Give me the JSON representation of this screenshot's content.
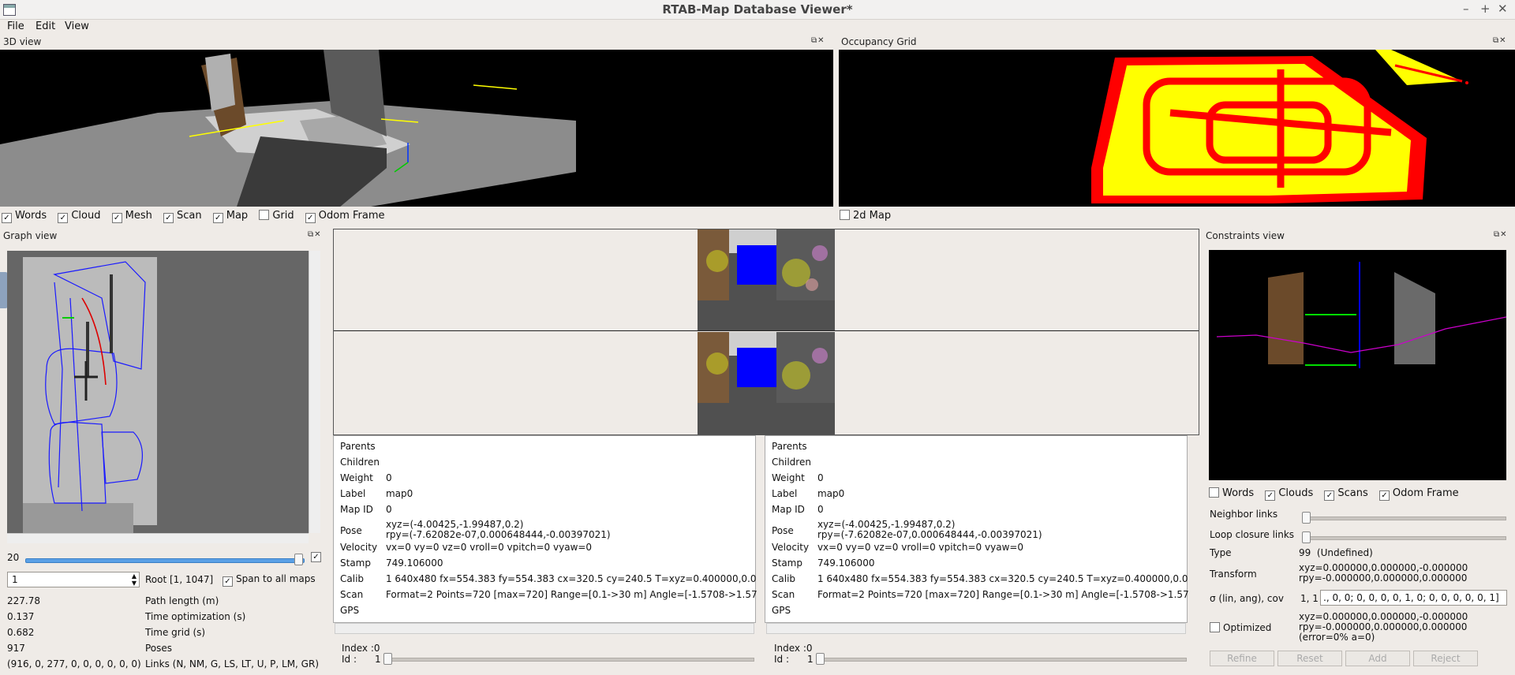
{
  "window": {
    "title": "RTAB-Map Database Viewer*",
    "controls": [
      "–",
      "+",
      "✕"
    ]
  },
  "menu": [
    "File",
    "Edit",
    "View"
  ],
  "view3d": {
    "title": "3D view",
    "checks": [
      {
        "label": "Words",
        "checked": true
      },
      {
        "label": "Cloud",
        "checked": true
      },
      {
        "label": "Mesh",
        "checked": true
      },
      {
        "label": "Scan",
        "checked": true
      },
      {
        "label": "Map",
        "checked": true
      },
      {
        "label": "Grid",
        "checked": false
      },
      {
        "label": "Odom Frame",
        "checked": true
      }
    ]
  },
  "occupancy": {
    "title": "Occupancy Grid",
    "check_label": "2d Map",
    "checked": false
  },
  "graph": {
    "title": "Graph view",
    "slider_value": "20",
    "id_input": "1",
    "root_label": "Root [1, 1047]",
    "span_label": "Span to all maps",
    "stats": [
      {
        "value": "227.78",
        "label": "Path length (m)"
      },
      {
        "value": "0.137",
        "label": "Time optimization (s)"
      },
      {
        "value": "0.682",
        "label": "Time grid (s)"
      },
      {
        "value": "917",
        "label": "Poses"
      },
      {
        "value": "(916, 0, 277, 0, 0, 0, 0, 0, 0)",
        "label": "Links (N, NM, G, LS, LT, U, P, LM, GR)"
      }
    ]
  },
  "info_left": {
    "rows": [
      {
        "k": "Parents",
        "v": ""
      },
      {
        "k": "Children",
        "v": ""
      },
      {
        "k": "Weight",
        "v": "0"
      },
      {
        "k": "Label",
        "v": "map0"
      },
      {
        "k": "Map ID",
        "v": "0"
      },
      {
        "k": "Pose",
        "v": "xyz=(-4.00425,-1.99487,0.2)",
        "v2": "rpy=(-7.62082e-07,0.000648444,-0.00397021)"
      },
      {
        "k": "Velocity",
        "v": "vx=0 vy=0 vz=0 vroll=0 vpitch=0 vyaw=0"
      },
      {
        "k": "Stamp",
        "v": "749.106000"
      },
      {
        "k": "Calib",
        "v": "1 640x480 fx=554.383 fy=554.383 cx=320.5 cy=240.5 T=xyz=0.400000,0.0"
      },
      {
        "k": "Scan",
        "v": "Format=2 Points=720 [max=720] Range=[0.1->30 m] Angle=[-1.5708->1.57"
      },
      {
        "k": "GPS",
        "v": ""
      }
    ],
    "index_label": "Index :",
    "index_value": "0",
    "id_label": "Id :",
    "id_value": "1"
  },
  "info_right": {
    "rows": [
      {
        "k": "Parents",
        "v": ""
      },
      {
        "k": "Children",
        "v": ""
      },
      {
        "k": "Weight",
        "v": "0"
      },
      {
        "k": "Label",
        "v": "map0"
      },
      {
        "k": "Map ID",
        "v": "0"
      },
      {
        "k": "Pose",
        "v": "xyz=(-4.00425,-1.99487,0.2)",
        "v2": "rpy=(-7.62082e-07,0.000648444,-0.00397021)"
      },
      {
        "k": "Velocity",
        "v": "vx=0 vy=0 vz=0 vroll=0 vpitch=0 vyaw=0"
      },
      {
        "k": "Stamp",
        "v": "749.106000"
      },
      {
        "k": "Calib",
        "v": "1 640x480 fx=554.383 fy=554.383 cx=320.5 cy=240.5 T=xyz=0.400000,0.0"
      },
      {
        "k": "Scan",
        "v": "Format=2 Points=720 [max=720] Range=[0.1->30 m] Angle=[-1.5708->1.57"
      },
      {
        "k": "GPS",
        "v": ""
      }
    ],
    "index_label": "Index :",
    "index_value": "0",
    "id_label": "Id :",
    "id_value": "1"
  },
  "constraints": {
    "title": "Constraints view",
    "checks": [
      {
        "label": "Words",
        "checked": false
      },
      {
        "label": "Clouds",
        "checked": true
      },
      {
        "label": "Scans",
        "checked": true
      },
      {
        "label": "Odom Frame",
        "checked": true
      }
    ],
    "neighbor_label": "Neighbor links",
    "loop_label": "Loop closure links",
    "type_label": "Type",
    "type_value": "99  (Undefined)",
    "transform_label": "Transform",
    "transform_xyz": "xyz=0.000000,0.000000,-0.000000",
    "transform_rpy": "rpy=-0.000000,0.000000,0.000000",
    "sigma_label": "σ (lin, ang), cov",
    "sigma_value": "1, 1",
    "cov_value": "., 0, 0;  0, 0, 0, 0, 1, 0;  0, 0, 0, 0, 0, 1]",
    "optimized_label": "Optimized",
    "opt_xyz": "xyz=0.000000,0.000000,-0.000000",
    "opt_rpy": "rpy=-0.000000,0.000000,0.000000",
    "opt_err": "(error=0% a=0)",
    "buttons": [
      "Refine",
      "Reset",
      "Add",
      "Reject"
    ]
  },
  "colors": {
    "occupied": "#ff0000",
    "free": "#ffff00",
    "graph_path": "#1a1aff",
    "loop": "#dd0000"
  }
}
